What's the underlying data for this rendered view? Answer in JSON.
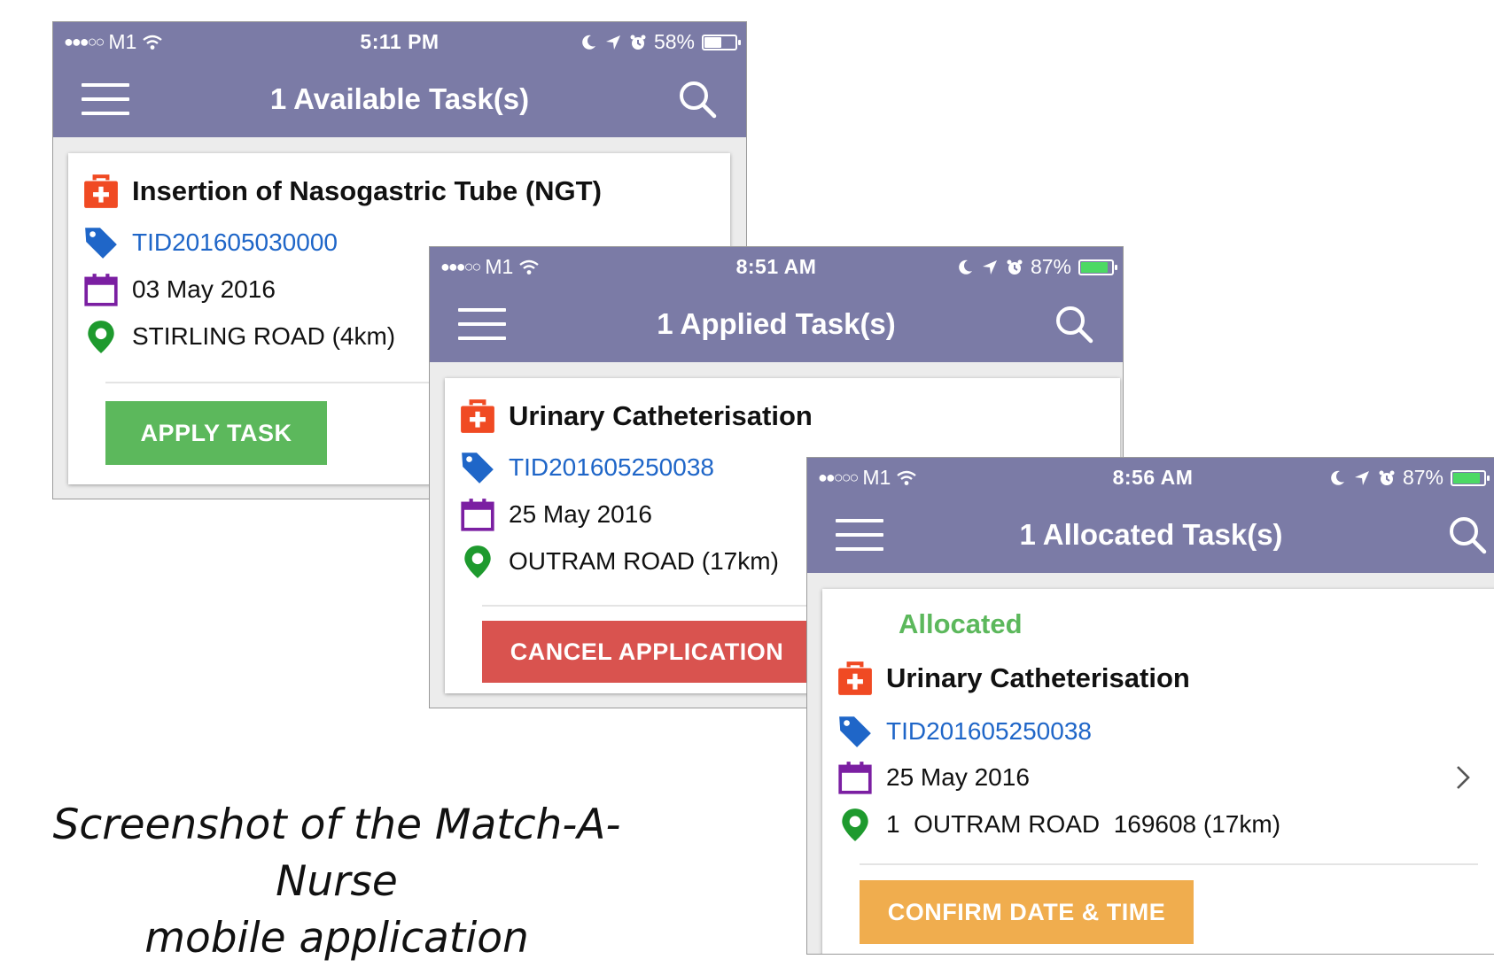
{
  "caption": {
    "line1": "Screenshot of the Match-A-Nurse",
    "line2": "mobile application"
  },
  "colors": {
    "nav_bar": "#7b7ba6",
    "apply_green": "#5cb85c",
    "cancel_red": "#d9534f",
    "confirm_orange": "#f0ad4e",
    "allocated_green": "#5cb85c",
    "tid_blue": "#1f66c8",
    "kit_red": "#f04a23",
    "calendar_purple": "#7b1fa2",
    "pin_green": "#1e9a2e",
    "battery_green": "#4cd964"
  },
  "screens": [
    {
      "status": {
        "carrier": "M1",
        "time": "5:11 PM",
        "battery": "58%"
      },
      "nav_title": "1 Available Task(s)",
      "card": {
        "title": "Insertion of Nasogastric Tube (NGT)",
        "tid": "TID201605030000",
        "date": "03 May 2016",
        "location": "STIRLING ROAD (4km)",
        "button": "APPLY TASK"
      }
    },
    {
      "status": {
        "carrier": "M1",
        "time": "8:51 AM",
        "battery": "87%"
      },
      "nav_title": "1 Applied Task(s)",
      "card": {
        "title": "Urinary Catheterisation",
        "tid": "TID201605250038",
        "date": "25 May 2016",
        "location": "OUTRAM ROAD (17km)",
        "button": "CANCEL APPLICATION"
      }
    },
    {
      "status": {
        "carrier": "M1",
        "time": "8:56 AM",
        "battery": "87%"
      },
      "nav_title": "1 Allocated Task(s)",
      "card": {
        "status_label": "Allocated",
        "title": "Urinary Catheterisation",
        "tid": "TID201605250038",
        "date": "25 May 2016",
        "location": "1  OUTRAM ROAD  169608 (17km)",
        "button": "CONFIRM DATE & TIME"
      }
    }
  ]
}
